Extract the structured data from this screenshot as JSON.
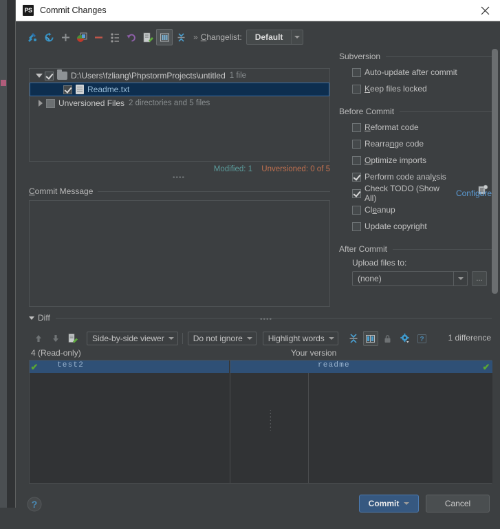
{
  "window": {
    "title": "Commit Changes",
    "app_icon": "PS",
    "close_icon": "close-icon"
  },
  "toolbar": {
    "icons": [
      {
        "name": "show-diff-icon",
        "glyph": "diff"
      },
      {
        "name": "refresh-icon",
        "glyph": "refresh"
      },
      {
        "name": "add-icon",
        "glyph": "plus"
      },
      {
        "name": "move-to-changelist-icon",
        "glyph": "movefile"
      },
      {
        "name": "remove-icon",
        "glyph": "minus"
      },
      {
        "name": "group-by-icon",
        "glyph": "grouplist"
      },
      {
        "name": "revert-icon",
        "glyph": "undo"
      },
      {
        "name": "edit-source-icon",
        "glyph": "editsrc"
      },
      {
        "name": "group-by-directory-icon",
        "glyph": "directory"
      },
      {
        "name": "expand-collapse-icon",
        "glyph": "collapse"
      }
    ],
    "overflow_label": "»",
    "changelist_label": "Changelist:",
    "changelist_value": "Default"
  },
  "tree": {
    "rows": [
      {
        "name": "changelist-root-row",
        "expander": "down",
        "checked": true,
        "icon": "folder-icon",
        "label": "D:\\Users\\fzliang\\PhpstormProjects\\untitled",
        "sublabel": "1 file",
        "selected": false,
        "indent": 0
      },
      {
        "name": "file-row-readme",
        "expander": "none",
        "checked": true,
        "icon": "file-icon",
        "label": "Readme.txt",
        "sublabel": "",
        "selected": true,
        "indent": 1
      },
      {
        "name": "unversioned-files-row",
        "expander": "right",
        "checked": false,
        "icon": "folder-grey-icon",
        "label": "Unversioned Files",
        "sublabel": "2 directories and 5 files",
        "selected": false,
        "indent": 0
      }
    ]
  },
  "counts": {
    "modified": "Modified: 1",
    "unversioned": "Unversioned: 0 of 5",
    "modified_color": "#5b9b9b",
    "unversioned_color": "#c0704f"
  },
  "commit_message": {
    "caption": "Commit Message",
    "value": "",
    "placeholder": "",
    "history_icon": "commit-history-icon"
  },
  "options": {
    "subversion": {
      "title": "Subversion",
      "items": [
        {
          "name": "auto-update-after-commit-checkbox",
          "label": "Auto-update after commit",
          "checked": false
        },
        {
          "name": "keep-files-locked-checkbox",
          "label": "Keep files locked",
          "checked": false
        }
      ]
    },
    "before_commit": {
      "title": "Before Commit",
      "items": [
        {
          "name": "reformat-code-checkbox",
          "label": "Reformat code",
          "checked": false
        },
        {
          "name": "rearrange-code-checkbox",
          "label": "Rearrange code",
          "checked": false
        },
        {
          "name": "optimize-imports-checkbox",
          "label": "Optimize imports",
          "checked": false
        },
        {
          "name": "perform-code-analysis-checkbox",
          "label": "Perform code analysis",
          "checked": true
        },
        {
          "name": "check-todo-checkbox",
          "label": "Check TODO (Show All)",
          "checked": true,
          "link": "Configure"
        },
        {
          "name": "cleanup-checkbox",
          "label": "Cleanup",
          "checked": false
        },
        {
          "name": "update-copyright-checkbox",
          "label": "Update copyright",
          "checked": false
        }
      ]
    },
    "after_commit": {
      "title": "After Commit",
      "upload_label": "Upload files to:",
      "upload_value": "(none)",
      "ellipsis_label": "..."
    }
  },
  "diff": {
    "section_title": "Diff",
    "prev_icon": "arrow-up-icon",
    "next_icon": "arrow-down-icon",
    "edit_icon": "edit-source-icon",
    "viewer_mode": "Side-by-side viewer",
    "whitespace_mode": "Do not ignore",
    "highlight_mode": "Highlight words",
    "buttons": [
      {
        "name": "collapse-unchanged-icon",
        "framed": false
      },
      {
        "name": "synchronize-scroll-icon",
        "framed": true
      },
      {
        "name": "read-only-lock-icon",
        "framed": false
      },
      {
        "name": "diff-settings-icon",
        "framed": false
      },
      {
        "name": "diff-help-icon",
        "framed": false
      }
    ],
    "difference_count": "1 difference",
    "left_header": "4 (Read-only)",
    "right_header": "Your version",
    "left_line_text": "test2",
    "right_line_text": "readme",
    "accept_left_icon": "accept-left-icon",
    "accept_right_icon": "accept-right-icon"
  },
  "footer": {
    "help_icon": "help-icon",
    "commit_label": "Commit",
    "commit_dropdown_icon": "chevron-down-icon",
    "cancel_label": "Cancel",
    "commit_color": "#365880"
  }
}
